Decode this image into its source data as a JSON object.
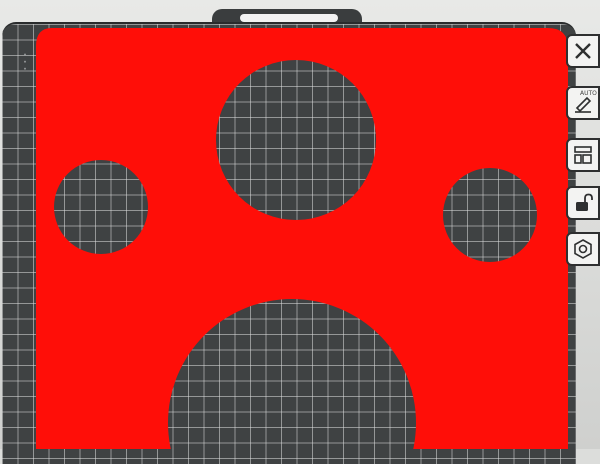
{
  "window": {
    "title": ""
  },
  "plate": {
    "edge_text": "...",
    "mask_color": "#ff0000",
    "grid_color": "#dcdcdc",
    "bed_color": "#3f4243"
  },
  "toolbar": {
    "items": [
      {
        "name": "close",
        "icon": "close-icon"
      },
      {
        "name": "auto-arrange",
        "icon": "auto-arrange-icon",
        "label": "AUTO"
      },
      {
        "name": "layout",
        "icon": "layout-icon"
      },
      {
        "name": "lock",
        "icon": "unlock-icon"
      },
      {
        "name": "settings",
        "icon": "settings-icon"
      }
    ]
  }
}
